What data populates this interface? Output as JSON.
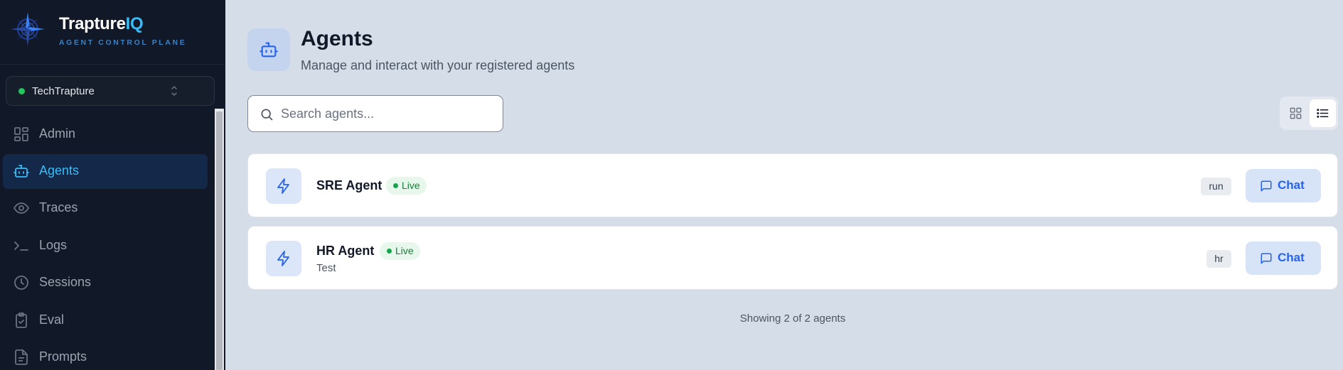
{
  "brand": {
    "name_main": "Trapture",
    "name_accent": "IQ",
    "subtitle": "AGENT CONTROL PLANE"
  },
  "org_switcher": {
    "name": "TechTrapture",
    "status_color": "#22c55e"
  },
  "sidebar": {
    "items": [
      {
        "label": "Admin",
        "icon": "dashboard-icon",
        "active": false
      },
      {
        "label": "Agents",
        "icon": "bot-icon",
        "active": true
      },
      {
        "label": "Traces",
        "icon": "eye-icon",
        "active": false
      },
      {
        "label": "Logs",
        "icon": "terminal-icon",
        "active": false
      },
      {
        "label": "Sessions",
        "icon": "clock-icon",
        "active": false
      },
      {
        "label": "Eval",
        "icon": "clipboard-check-icon",
        "active": false
      },
      {
        "label": "Prompts",
        "icon": "file-icon",
        "active": false
      }
    ]
  },
  "header": {
    "title": "Agents",
    "subtitle": "Manage and interact with your registered agents"
  },
  "search": {
    "placeholder": "Search agents...",
    "value": ""
  },
  "view_toggle": {
    "grid_label": "grid-view",
    "list_label": "list-view",
    "selected": "list"
  },
  "agents": [
    {
      "name": "SRE Agent",
      "status": "Live",
      "description": "",
      "tag": "run",
      "action": "Chat"
    },
    {
      "name": "HR Agent",
      "status": "Live",
      "description": "Test",
      "tag": "hr",
      "action": "Chat"
    }
  ],
  "footer": {
    "count_text": "Showing 2 of 2 agents"
  },
  "colors": {
    "accent": "#38bdf8",
    "primary": "#2563eb",
    "sidebar_bg": "#111827",
    "main_bg": "#d5dde8",
    "live_green": "#16a34a"
  }
}
